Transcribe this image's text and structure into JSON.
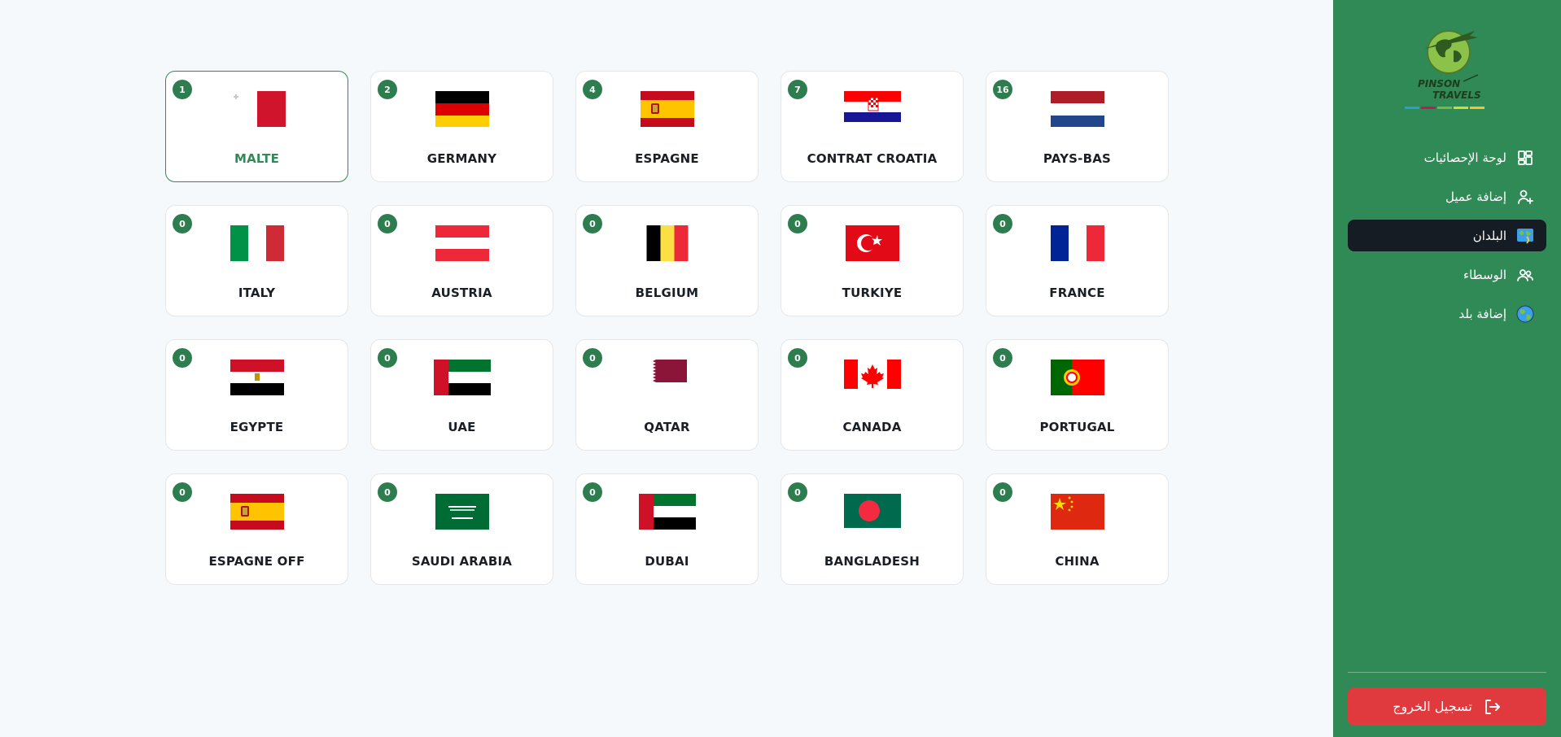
{
  "countries": [
    {
      "name": "MALTE",
      "count": "1",
      "flag": "malta-flag-icon",
      "active": true
    },
    {
      "name": "GERMANY",
      "count": "2",
      "flag": "germany-flag-icon"
    },
    {
      "name": "ESPAGNE",
      "count": "4",
      "flag": "spain-flag-icon"
    },
    {
      "name": "CONTRAT CROATIA",
      "count": "7",
      "flag": "croatia-flag-icon"
    },
    {
      "name": "PAYS-BAS",
      "count": "16",
      "flag": "netherlands-flag-icon"
    },
    {
      "name": "ITALY",
      "count": "0",
      "flag": "italy-flag-icon"
    },
    {
      "name": "AUSTRIA",
      "count": "0",
      "flag": "austria-flag-icon"
    },
    {
      "name": "BELGIUM",
      "count": "0",
      "flag": "belgium-flag-icon"
    },
    {
      "name": "TURKIYE",
      "count": "0",
      "flag": "turkey-flag-icon"
    },
    {
      "name": "FRANCE",
      "count": "0",
      "flag": "france-flag-icon"
    },
    {
      "name": "EGYPTE",
      "count": "0",
      "flag": "egypt-flag-icon"
    },
    {
      "name": "UAE",
      "count": "0",
      "flag": "uae-flag-icon"
    },
    {
      "name": "QATAR",
      "count": "0",
      "flag": "qatar-flag-icon"
    },
    {
      "name": "CANADA",
      "count": "0",
      "flag": "canada-flag-icon"
    },
    {
      "name": "PORTUGAL",
      "count": "0",
      "flag": "portugal-flag-icon"
    },
    {
      "name": "ESPAGNE OFF",
      "count": "0",
      "flag": "spain-flag-icon"
    },
    {
      "name": "SAUDI ARABIA",
      "count": "0",
      "flag": "saudi-arabia-flag-icon"
    },
    {
      "name": "DUBAI",
      "count": "0",
      "flag": "uae-flag-icon"
    },
    {
      "name": "BANGLADESH",
      "count": "0",
      "flag": "bangladesh-flag-icon"
    },
    {
      "name": "CHINA",
      "count": "0",
      "flag": "china-flag-icon"
    }
  ],
  "sidebar": {
    "logo_text_1": "PINSON",
    "logo_text_2": "TRAVELS",
    "items": [
      {
        "label": "لوحة الإحصائيات",
        "icon": "dashboard-icon",
        "name": "sidebar-item-dashboard"
      },
      {
        "label": "إضافة عميل",
        "icon": "add-user-icon",
        "name": "sidebar-item-add-client"
      },
      {
        "label": "البلدان",
        "icon": "world-map-icon",
        "name": "sidebar-item-countries",
        "active": true
      },
      {
        "label": "الوسطاء",
        "icon": "users-icon",
        "name": "sidebar-item-agents"
      },
      {
        "label": "إضافة بلد",
        "icon": "globe-icon",
        "name": "sidebar-item-add-country"
      }
    ],
    "logout_label": "تسجيل الخروج"
  },
  "colors": {
    "sidebar": "#2f8a56",
    "badge": "#2e7d4f",
    "active_nav": "#151c24",
    "logout": "#e03a3e",
    "background": "#f6f9fb"
  }
}
